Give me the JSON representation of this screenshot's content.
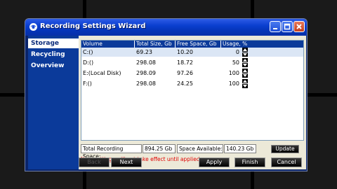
{
  "window": {
    "title": "Recording Settings Wizard"
  },
  "sidebar": {
    "items": [
      {
        "label": "Storage",
        "active": true
      },
      {
        "label": "Recycling",
        "active": false
      },
      {
        "label": "Overview",
        "active": false
      }
    ]
  },
  "storage_table": {
    "columns": [
      "Volume",
      "Total Size, Gb",
      "Free Space, Gb",
      "Usage, %"
    ],
    "rows": [
      {
        "volume": "C:()",
        "total": "69.23",
        "free": "10.20",
        "usage": "0"
      },
      {
        "volume": "D:()",
        "total": "298.08",
        "free": "18.72",
        "usage": "50"
      },
      {
        "volume": "E:(Local Disk)",
        "total": "298.09",
        "free": "97.26",
        "usage": "100"
      },
      {
        "volume": "F:()",
        "total": "298.08",
        "free": "24.25",
        "usage": "100"
      }
    ]
  },
  "totals": {
    "total_label": "Total Recording Space:",
    "total_value": "894.25 Gb",
    "available_label": "Space Available:",
    "available_value": "140.23 Gb",
    "update_label": "Update"
  },
  "warning": "New settings will not take effect until applied",
  "buttons": {
    "back": "Back",
    "next": "Next",
    "apply": "Apply",
    "finish": "Finish",
    "cancel": "Cancel"
  },
  "colors": {
    "titlebar": "#0535b8",
    "sidebar": "#0b3a9a",
    "panel": "#ece9d8",
    "warning": "#e00000"
  }
}
